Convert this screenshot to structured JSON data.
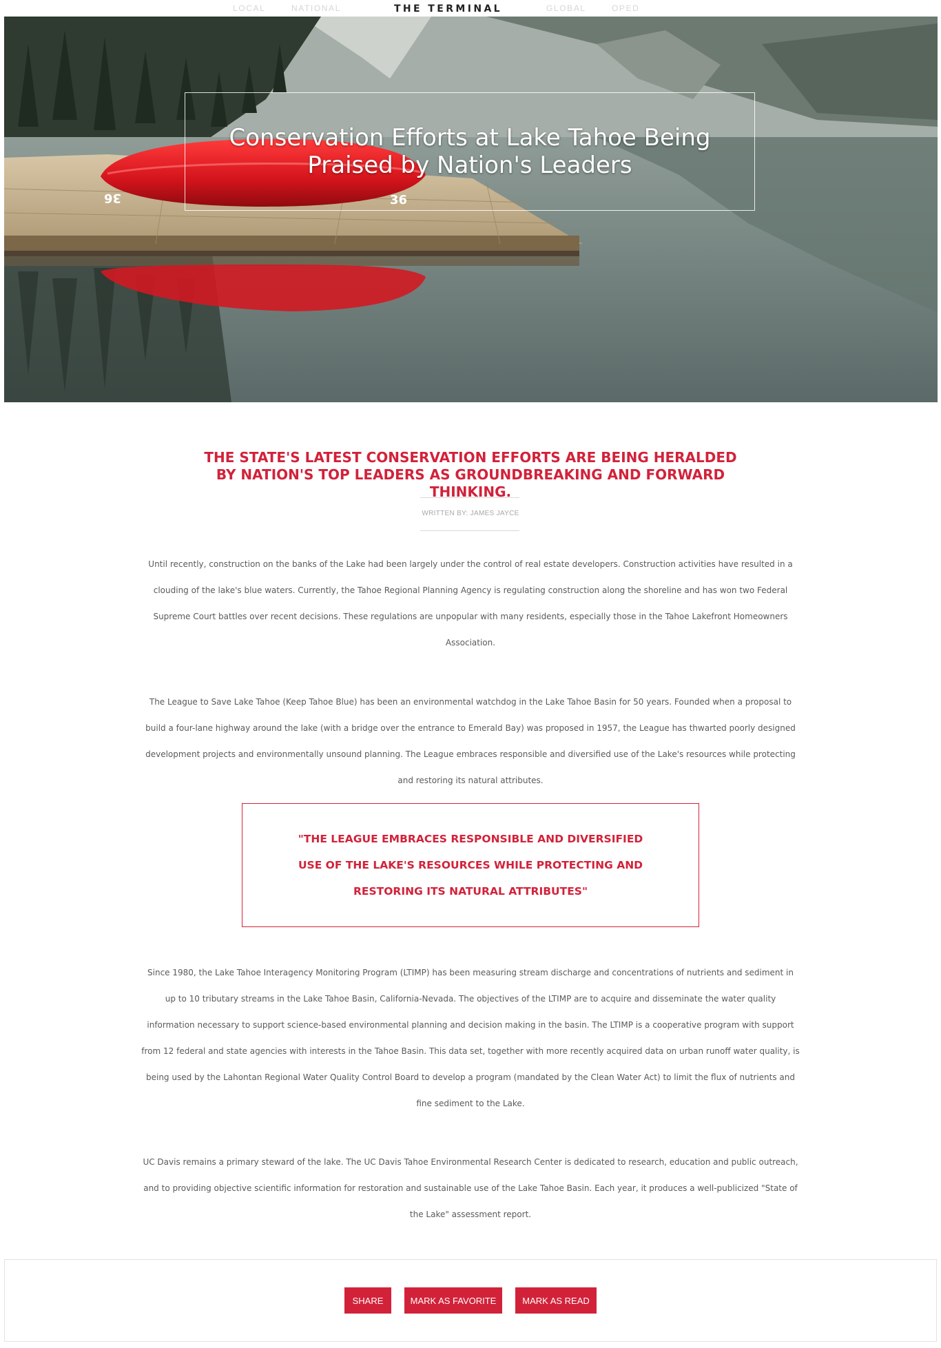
{
  "nav": {
    "brand": "THE TERMINAL",
    "links": [
      "LOCAL",
      "NATIONAL",
      "GLOBAL",
      "OPED"
    ]
  },
  "hero": {
    "title": "Conservation Efforts at Lake Tahoe Being Praised by Nation's Leaders",
    "canoe_label": "36"
  },
  "article": {
    "subtitle": "THE STATE'S LATEST CONSERVATION EFFORTS ARE BEING HERALDED BY NATION'S TOP LEADERS AS GROUNDBREAKING AND FORWARD THINKING.",
    "byline": "WRITTEN BY: JAMES JAYCE",
    "paragraphs": [
      "Until recently, construction on the banks of the Lake had been largely under the control of real estate developers. Construction activities have resulted in a clouding of the lake's blue waters. Currently, the Tahoe Regional Planning Agency is regulating construction along the shoreline and has won two Federal Supreme Court battles over recent decisions. These regulations are unpopular with many residents, especially those in the Tahoe Lakefront Homeowners Association.",
      "The League to Save Lake Tahoe (Keep Tahoe Blue) has been an environmental watchdog in the Lake Tahoe Basin for 50 years. Founded when a proposal to build a four-lane highway around the lake (with a bridge over the entrance to Emerald Bay) was proposed in 1957, the League has thwarted poorly designed development projects and environmentally unsound planning. The League embraces responsible and diversified use of the Lake's resources while protecting and restoring its natural attributes.",
      "Since 1980, the Lake Tahoe Interagency Monitoring Program (LTIMP) has been measuring stream discharge and concentrations of nutrients and sediment in up to 10 tributary streams in the Lake Tahoe Basin, California-Nevada. The objectives of the LTIMP are to acquire and disseminate the water quality information necessary to support science-based environmental planning and decision making in the basin. The LTIMP is a cooperative program with support from 12 federal and state agencies with interests in the Tahoe Basin. This data set, together with more recently acquired data on urban runoff water quality, is being used by the Lahontan Regional Water Quality Control Board to develop a program (mandated by the Clean Water Act) to limit the flux of nutrients and fine sediment to the Lake.",
      "UC Davis remains a primary steward of the lake. The UC Davis Tahoe Environmental Research Center is dedicated to research, education and public outreach, and to providing objective scientific information for restoration and sustainable use of the Lake Tahoe Basin. Each year, it produces a well-publicized \"State of the Lake\" assessment report."
    ],
    "pullquote": "\"THE LEAGUE EMBRACES RESPONSIBLE AND DIVERSIFIED USE OF THE LAKE'S RESOURCES WHILE PROTECTING AND RESTORING ITS NATURAL ATTRIBUTES\""
  },
  "actions": {
    "share": "SHARE",
    "favorite": "MARK AS FAVORITE",
    "read": "MARK AS READ"
  },
  "colors": {
    "accent": "#d2223a",
    "body_text": "#5a5a5a",
    "nav_inactive": "#d6d6d6"
  }
}
